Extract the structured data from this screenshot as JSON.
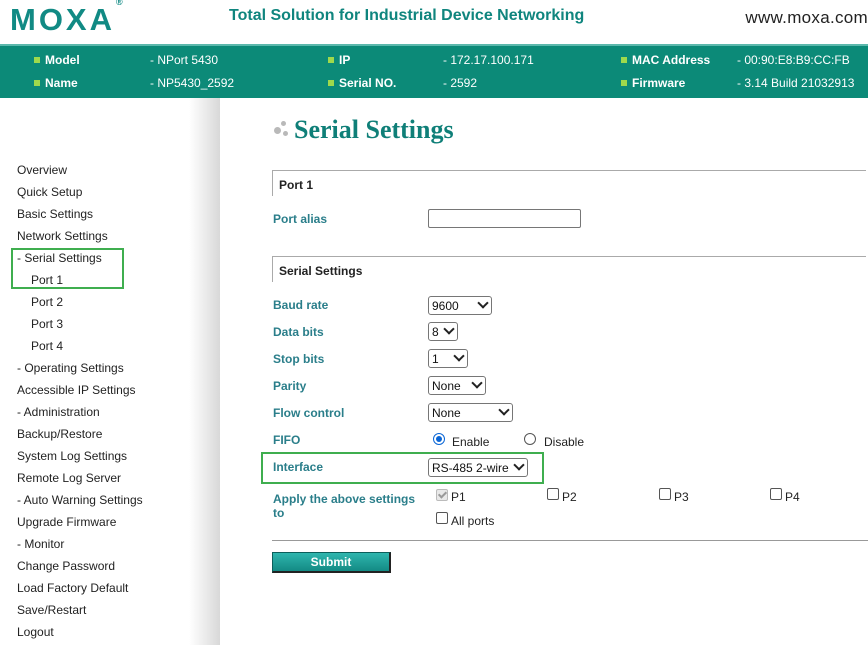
{
  "header": {
    "logo": "MOXA",
    "logo_mark": "®",
    "tagline": "Total Solution for Industrial Device Networking",
    "website": "www.moxa.com"
  },
  "device_info": {
    "model_label": "Model",
    "model_value": "- NPort 5430",
    "name_label": "Name",
    "name_value": "- NP5430_2592",
    "ip_label": "IP",
    "ip_value": "- 172.17.100.171",
    "serial_label": "Serial NO.",
    "serial_value": "- 2592",
    "mac_label": "MAC Address",
    "mac_value": "- 00:90:E8:B9:CC:FB",
    "firmware_label": "Firmware",
    "firmware_value": "- 3.14 Build 21032913"
  },
  "sidebar": {
    "items": [
      {
        "label": "Overview"
      },
      {
        "label": "Quick Setup"
      },
      {
        "label": "Basic Settings"
      },
      {
        "label": "Network Settings"
      },
      {
        "label": "- Serial Settings"
      },
      {
        "label": "Port 1"
      },
      {
        "label": "Port 2"
      },
      {
        "label": "Port 3"
      },
      {
        "label": "Port 4"
      },
      {
        "label": "- Operating Settings"
      },
      {
        "label": "Accessible IP Settings"
      },
      {
        "label": "- Administration"
      },
      {
        "label": "Backup/Restore"
      },
      {
        "label": "System Log Settings"
      },
      {
        "label": "Remote Log Server"
      },
      {
        "label": "- Auto Warning Settings"
      },
      {
        "label": "Upgrade Firmware"
      },
      {
        "label": "- Monitor"
      },
      {
        "label": "Change Password"
      },
      {
        "label": "Load Factory Default"
      },
      {
        "label": "Save/Restart"
      },
      {
        "label": "Logout"
      }
    ]
  },
  "main": {
    "title": "Serial Settings",
    "port_section": "Port 1",
    "port_alias_label": "Port alias",
    "port_alias_value": "",
    "serial_section": "Serial Settings",
    "baud_rate_label": "Baud rate",
    "baud_rate_value": "9600",
    "data_bits_label": "Data bits",
    "data_bits_value": "8",
    "stop_bits_label": "Stop bits",
    "stop_bits_value": "1",
    "parity_label": "Parity",
    "parity_value": "None",
    "flow_control_label": "Flow control",
    "flow_control_value": "None",
    "fifo_label": "FIFO",
    "fifo_enable": "Enable",
    "fifo_disable": "Disable",
    "interface_label": "Interface",
    "interface_value": "RS-485 2-wire",
    "apply_label_line1": "Apply the above settings",
    "apply_label_line2": "to",
    "apply_p1": "P1",
    "apply_p2": "P2",
    "apply_p3": "P3",
    "apply_p4": "P4",
    "apply_all": "All ports",
    "submit_label": "Submit"
  },
  "colors": {
    "brand_teal": "#0c8a78",
    "label_teal": "#2a7e8a",
    "highlight_green": "#3fae4f"
  }
}
